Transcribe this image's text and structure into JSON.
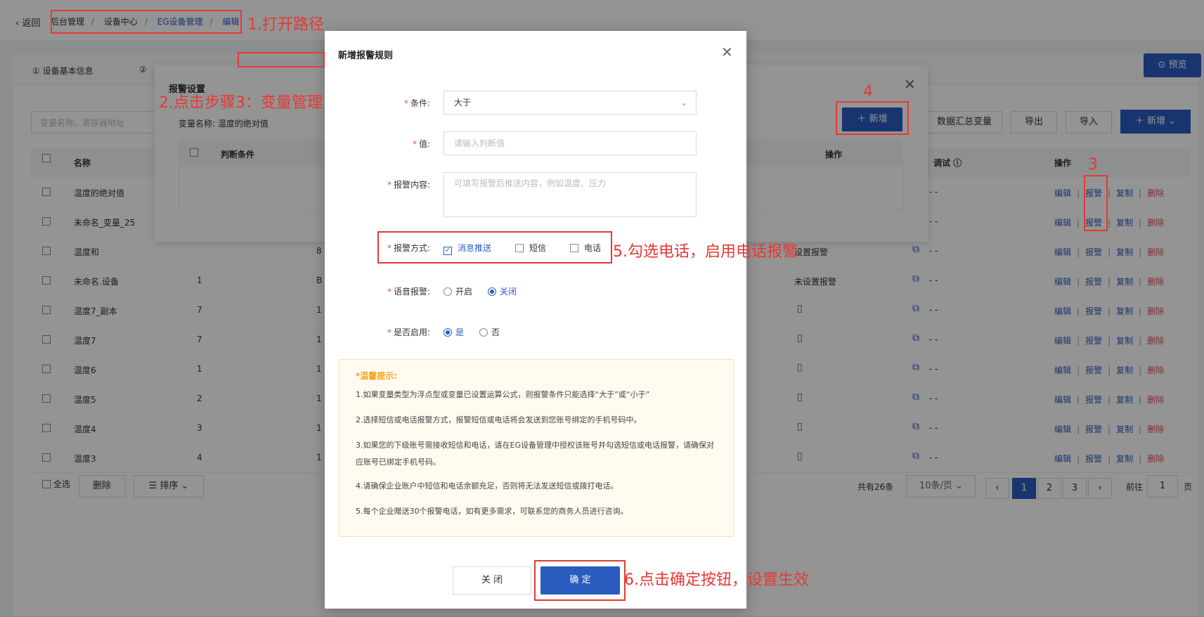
{
  "header": {
    "back": "返回",
    "breadcrumb": [
      "后台管理",
      "设备中心",
      "EG设备管理",
      "编辑"
    ],
    "preview": "预览"
  },
  "steps": {
    "tab1": "① 设备基本信息",
    "tab2": "②"
  },
  "toolbar": {
    "search_placeholder": "变量名称、寄存器地址",
    "summary": "数据汇总变量",
    "export": "导出",
    "import": "导入",
    "add": "新增"
  },
  "table": {
    "headers": {
      "name": "名称",
      "debug": "调试",
      "ops": "操作"
    },
    "rows": [
      {
        "name": "温度的绝对值",
        "c2": "",
        "c3": "",
        "alarm": "",
        "debug": "- -"
      },
      {
        "name": "未命名_变量_25",
        "c2": "",
        "c3": "",
        "alarm": "",
        "debug": "- -"
      },
      {
        "name": "温度和",
        "c2": "",
        "c3": "8",
        "alarm": "设置报警",
        "debug": "- -"
      },
      {
        "name": "未命名.设备",
        "c2": "1",
        "c3": "B",
        "alarm": "未设置报警",
        "debug": "- -"
      },
      {
        "name": "温度7_副本",
        "c2": "7",
        "c3": "1",
        "alarm": "",
        "debug": "- -"
      },
      {
        "name": "温度7",
        "c2": "7",
        "c3": "1",
        "alarm": "",
        "debug": "- -"
      },
      {
        "name": "温度6",
        "c2": "1",
        "c3": "1",
        "alarm": "",
        "debug": "- -"
      },
      {
        "name": "温度5",
        "c2": "2",
        "c3": "1",
        "alarm": "",
        "debug": "- -"
      },
      {
        "name": "温度4",
        "c2": "3",
        "c3": "1",
        "alarm": "",
        "debug": "- -"
      },
      {
        "name": "温度3",
        "c2": "4",
        "c3": "1",
        "alarm": "",
        "debug": "- -"
      }
    ],
    "op_labels": {
      "edit": "编辑",
      "alarm": "报警",
      "copy": "复制",
      "delete": "删除"
    }
  },
  "footer": {
    "select_all": "全选",
    "delete": "删除",
    "sort": "排序",
    "total": "共有26条",
    "page_size": "10条/页",
    "pages": [
      "1",
      "2",
      "3"
    ],
    "goto_prefix": "前往",
    "goto_value": "1",
    "goto_suffix": "页"
  },
  "alarm_panel": {
    "title": "报警设置",
    "var_label": "变量名称: 温度的绝对值",
    "col_condition": "判断条件",
    "col_ops": "操作",
    "add": "新增"
  },
  "modal": {
    "title": "新增报警规则",
    "condition_label": "条件:",
    "condition_value": "大于",
    "value_label": "值:",
    "value_placeholder": "请输入判断值",
    "content_label": "报警内容:",
    "content_placeholder": "可填写报警后推送内容，例如温度、压力",
    "method_label": "报警方式:",
    "method_push": "消息推送",
    "method_sms": "短信",
    "method_phone": "电话",
    "voice_label": "语音报警:",
    "voice_on": "开启",
    "voice_off": "关闭",
    "enable_label": "是否启用:",
    "enable_yes": "是",
    "enable_no": "否",
    "tips_title": "*温馨提示:",
    "tips": [
      "1.如果变量类型为浮点型或变量已设置运算公式，则报警条件只能选择“大于”或“小于”",
      "2.选择短信或电话报警方式，报警短信或电话将会发送到您账号绑定的手机号码中。",
      "3.如果您的下级账号需接收短信和电话，请在EG设备管理中授权该账号并勾选短信或电话报警，请确保对应账号已绑定手机号码。",
      "4.请确保企业账户中短信和电话余额充足，否则将无法发送短信或拨打电话。",
      "5.每个企业赠送30个报警电话，如有更多需求，可联系您的商务人员进行咨询。"
    ],
    "cancel": "关 闭",
    "ok": "确 定"
  },
  "annotations": {
    "a1": "1.打开路径",
    "a2": "2.点击步骤3：变量管理",
    "a3": "3",
    "a4": "4",
    "a5": "5.勾选电话，启用电话报警",
    "a6": "6.点击确定按钮，设置生效"
  }
}
